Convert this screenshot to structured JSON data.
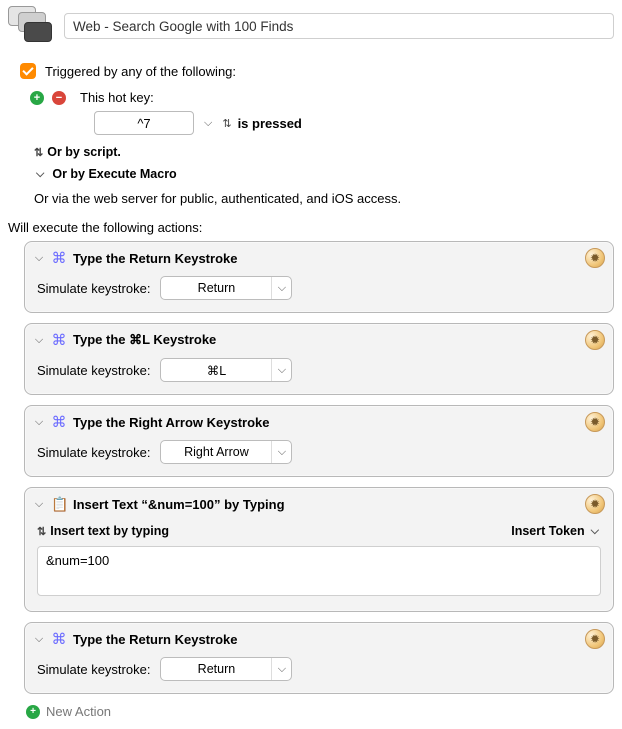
{
  "header": {
    "title": "Web - Search Google with 100 Finds"
  },
  "trigger": {
    "line": "Triggered by any of the following:",
    "hotkey_label": "This hot key:",
    "hotkey_value": "^7",
    "pressed_label": "is pressed",
    "or_script": "Or by script.",
    "or_execute_macro": "Or by Execute Macro",
    "or_webserver": "Or via the web server for public, authenticated, and iOS access."
  },
  "execute_line": "Will execute the following actions:",
  "labels": {
    "simulate": "Simulate keystroke:",
    "insert_by_typing": "Insert text by typing",
    "insert_token": "Insert Token",
    "new_action": "New Action"
  },
  "actions": [
    {
      "title": "Type the Return Keystroke",
      "select_value": "Return"
    },
    {
      "title": "Type the ⌘L Keystroke",
      "select_value": "⌘L"
    },
    {
      "title": "Type the Right Arrow Keystroke",
      "select_value": "Right Arrow"
    },
    {
      "title": "Insert Text “&num=100” by Typing",
      "text_value": "&num=100",
      "is_insert": true
    },
    {
      "title": "Type the Return Keystroke",
      "select_value": "Return"
    }
  ]
}
